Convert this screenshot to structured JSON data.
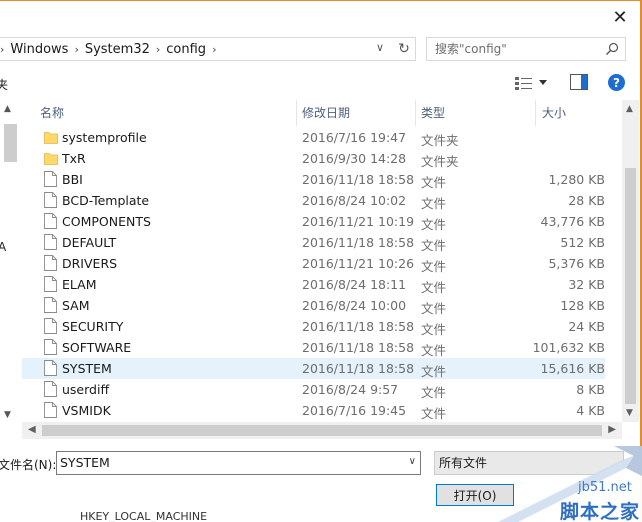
{
  "window": {
    "close_glyph": "✕"
  },
  "address": {
    "crumbs": [
      "Windows",
      "System32",
      "config"
    ]
  },
  "search": {
    "placeholder": "搜索\"config\""
  },
  "toolbar": {
    "cut_text": "夹"
  },
  "nav": {
    "letter": "A"
  },
  "columns": {
    "name": "名称",
    "date": "修改日期",
    "type": "类型",
    "size": "大小"
  },
  "files": [
    {
      "name": "systemprofile",
      "date": "2016/7/16 19:47",
      "type": "文件夹",
      "size": "",
      "kind": "folder"
    },
    {
      "name": "TxR",
      "date": "2016/9/30 14:28",
      "type": "文件夹",
      "size": "",
      "kind": "folder"
    },
    {
      "name": "BBI",
      "date": "2016/11/18 18:58",
      "type": "文件",
      "size": "1,280 KB",
      "kind": "file"
    },
    {
      "name": "BCD-Template",
      "date": "2016/8/24 10:02",
      "type": "文件",
      "size": "28 KB",
      "kind": "file"
    },
    {
      "name": "COMPONENTS",
      "date": "2016/11/21 10:19",
      "type": "文件",
      "size": "43,776 KB",
      "kind": "file"
    },
    {
      "name": "DEFAULT",
      "date": "2016/11/18 18:58",
      "type": "文件",
      "size": "512 KB",
      "kind": "file"
    },
    {
      "name": "DRIVERS",
      "date": "2016/11/21 10:26",
      "type": "文件",
      "size": "5,376 KB",
      "kind": "file"
    },
    {
      "name": "ELAM",
      "date": "2016/8/24 18:11",
      "type": "文件",
      "size": "32 KB",
      "kind": "file"
    },
    {
      "name": "SAM",
      "date": "2016/8/24 10:00",
      "type": "文件",
      "size": "128 KB",
      "kind": "file"
    },
    {
      "name": "SECURITY",
      "date": "2016/11/18 18:58",
      "type": "文件",
      "size": "24 KB",
      "kind": "file"
    },
    {
      "name": "SOFTWARE",
      "date": "2016/11/18 18:58",
      "type": "文件",
      "size": "101,632 KB",
      "kind": "file"
    },
    {
      "name": "SYSTEM",
      "date": "2016/11/18 18:58",
      "type": "文件",
      "size": "15,616 KB",
      "kind": "file",
      "selected": true
    },
    {
      "name": "userdiff",
      "date": "2016/8/24 9:57",
      "type": "文件",
      "size": "8 KB",
      "kind": "file"
    },
    {
      "name": "VSMIDK",
      "date": "2016/7/16 19:45",
      "type": "文件",
      "size": "4 KB",
      "kind": "file"
    }
  ],
  "bottom": {
    "filename_label": "文件名(N):",
    "filename_value": "SYSTEM",
    "filter": "所有文件",
    "open_label": "打开(O)",
    "background_text": "HKEY_LOCAL_MACHINE"
  },
  "watermark": {
    "site": "jb51.net",
    "cn": "脚本之家"
  },
  "colors": {
    "folder": "#ffd86a",
    "selected_row": "#e5f1fb",
    "accent": "#0078d7",
    "help": "#1c6fd1"
  }
}
